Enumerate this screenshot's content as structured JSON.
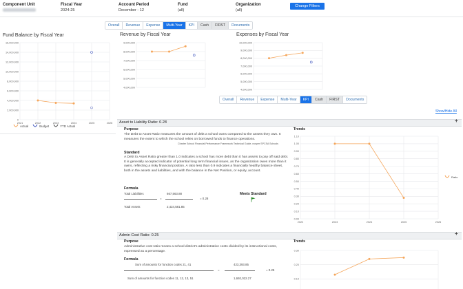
{
  "filters": {
    "component_unit_label": "Component Unit",
    "fiscal_year_label": "Fiscal Year",
    "fiscal_year_value": "2024-25",
    "account_period_label": "Account Period",
    "account_period_value": "December - 12",
    "fund_label": "Fund",
    "fund_value": "(all)",
    "organization_label": "Organization",
    "organization_value": "(all)",
    "change_filters_label": "Change Filters"
  },
  "top_tabs": [
    "Overall",
    "Revenue",
    "Expense",
    "Multi-Year",
    "KPI",
    "Cash",
    "FIRST",
    "Documents"
  ],
  "top_tabs_active": "Multi-Year",
  "kpi_tabs": [
    "Overall",
    "Revenue",
    "Expense",
    "Multi-Year",
    "KPI",
    "Cash",
    "FIRST",
    "Documents"
  ],
  "kpi_tabs_active": "KPI",
  "fund_chart_title": "Fund Balance by Fiscal Year",
  "revenue_chart_title": "Revenue by Fiscal Year",
  "expense_chart_title": "Expenses by Fiscal Year",
  "legend": {
    "actual": "Actual",
    "budget": "Budget",
    "ytd": "YTD Actual"
  },
  "show_hide_all": "Show/Hide All",
  "colors": {
    "actual": "#f5a65b",
    "budget": "#4a5fc1",
    "accent": "#1a73e8",
    "met": "#2a8a2a"
  },
  "kpi1": {
    "header": "Asset to Liability Ratio: 0.28",
    "purpose_title": "Purpose",
    "purpose_text": "The Debt to Asset Ratio measures the amount of debt a school owns compared to the assets they own. It measures the extent to which the school relies on borrowed funds to finance operations.",
    "source": "Charter School Financial Performance Framework Technical Guide, ncsper SPCSA Schools",
    "standard_title": "Standard",
    "standard_text": "A Debt to Asset Ratio greater than 1.0 indicates a school has more debt than it has assets to pay off said debt. It is generally accepted indicator of potential long term financial issues, as the organization owes more than it owns, reflecting a risky financial position. A ratio less than 0.9 indicates a financially healthy balance sheet, both in the assets and liabilities, and with the balance in the Net Position, or equity, account.",
    "formula_title": "Formula",
    "numerator_label": "Total Liabilities",
    "numerator_value": "667,563.88",
    "denominator_label": "Total Assets",
    "denominator_value": "2,424,581.85",
    "eq": "=",
    "result": "= 0.28",
    "meets_label": "Meets Standard",
    "trends_title": "Trends",
    "legend_ratio": "Ratio"
  },
  "kpi2": {
    "header": "Admin Cost Ratio: 0.25",
    "purpose_title": "Purpose",
    "purpose_text": "Administrative cost ratio means a school district's administrative costs divided by its instructional costs, expressed as a percentage.",
    "formula_title": "Formula",
    "numerator_label": "Sum of amounts for function codes 21, 41",
    "numerator_value": "423,393.85",
    "denominator_label": "Sum of amounts for function codes 11, 12, 13, 51",
    "denominator_value": "1,692,022.27",
    "eq": "=",
    "result": "= 0.25",
    "trends_title": "Trends"
  },
  "chart_data": [
    {
      "type": "line",
      "title": "Fund Balance by Fiscal Year",
      "x": [
        2021,
        2022,
        2023,
        2024,
        2025,
        2026
      ],
      "series": [
        {
          "name": "Actual",
          "x": [
            2022,
            2023,
            2024
          ],
          "values": [
            4000000,
            3500000,
            3400000
          ]
        },
        {
          "name": "Budget",
          "x": [
            2025
          ],
          "values": [
            14000000
          ]
        },
        {
          "name": "YTD Actual",
          "x": [
            2025
          ],
          "values": [
            2500000
          ]
        }
      ],
      "yticks": [
        "0",
        "2,000,000",
        "4,000,000",
        "6,000,000",
        "8,000,000",
        "10,000,000",
        "12,000,000",
        "14,000,000",
        "16,000,000"
      ],
      "ylim": [
        0,
        16000000
      ]
    },
    {
      "type": "line",
      "title": "Revenue by Fiscal Year",
      "series": [
        {
          "name": "Actual",
          "values": [
            8000000,
            8000000,
            8600000
          ]
        },
        {
          "name": "Budget",
          "values": [
            7600000
          ]
        }
      ],
      "yticks": [
        "4,000,000",
        "5,000,000",
        "6,000,000",
        "7,000,000",
        "8,000,000",
        "9,000,000"
      ],
      "ylim": [
        4000000,
        9000000
      ]
    },
    {
      "type": "line",
      "title": "Expenses by Fiscal Year",
      "series": [
        {
          "name": "Actual",
          "values": [
            8000000,
            8400000,
            8700000
          ]
        },
        {
          "name": "Budget",
          "values": [
            7500000
          ]
        }
      ],
      "yticks": [
        "4,000,000",
        "5,000,000",
        "6,000,000",
        "7,000,000",
        "8,000,000",
        "9,000,000",
        "10,000,000"
      ],
      "ylim": [
        4000000,
        10000000
      ]
    },
    {
      "type": "line",
      "title": "Trends",
      "x": [
        2022,
        2023,
        2024,
        2025,
        2026
      ],
      "series": [
        {
          "name": "Ratio",
          "x": [
            2023,
            2024,
            2025
          ],
          "values": [
            1.0,
            1.0,
            0.28
          ]
        }
      ],
      "yticks": [
        "0.00",
        "0.10",
        "0.20",
        "0.30",
        "0.40",
        "0.50",
        "0.60",
        "0.70",
        "0.80",
        "0.90",
        "1.00",
        "1.10"
      ],
      "ylim": [
        0,
        1.1
      ]
    },
    {
      "type": "line",
      "title": "Trends",
      "series": [
        {
          "name": "Ratio",
          "x": [
            2023,
            2024,
            2025
          ],
          "values": [
            0.13,
            0.24,
            0.25
          ]
        }
      ],
      "yticks": [
        "0.00",
        "0.10",
        "0.20",
        "0.30"
      ],
      "ylim": [
        0,
        0.3
      ]
    }
  ]
}
